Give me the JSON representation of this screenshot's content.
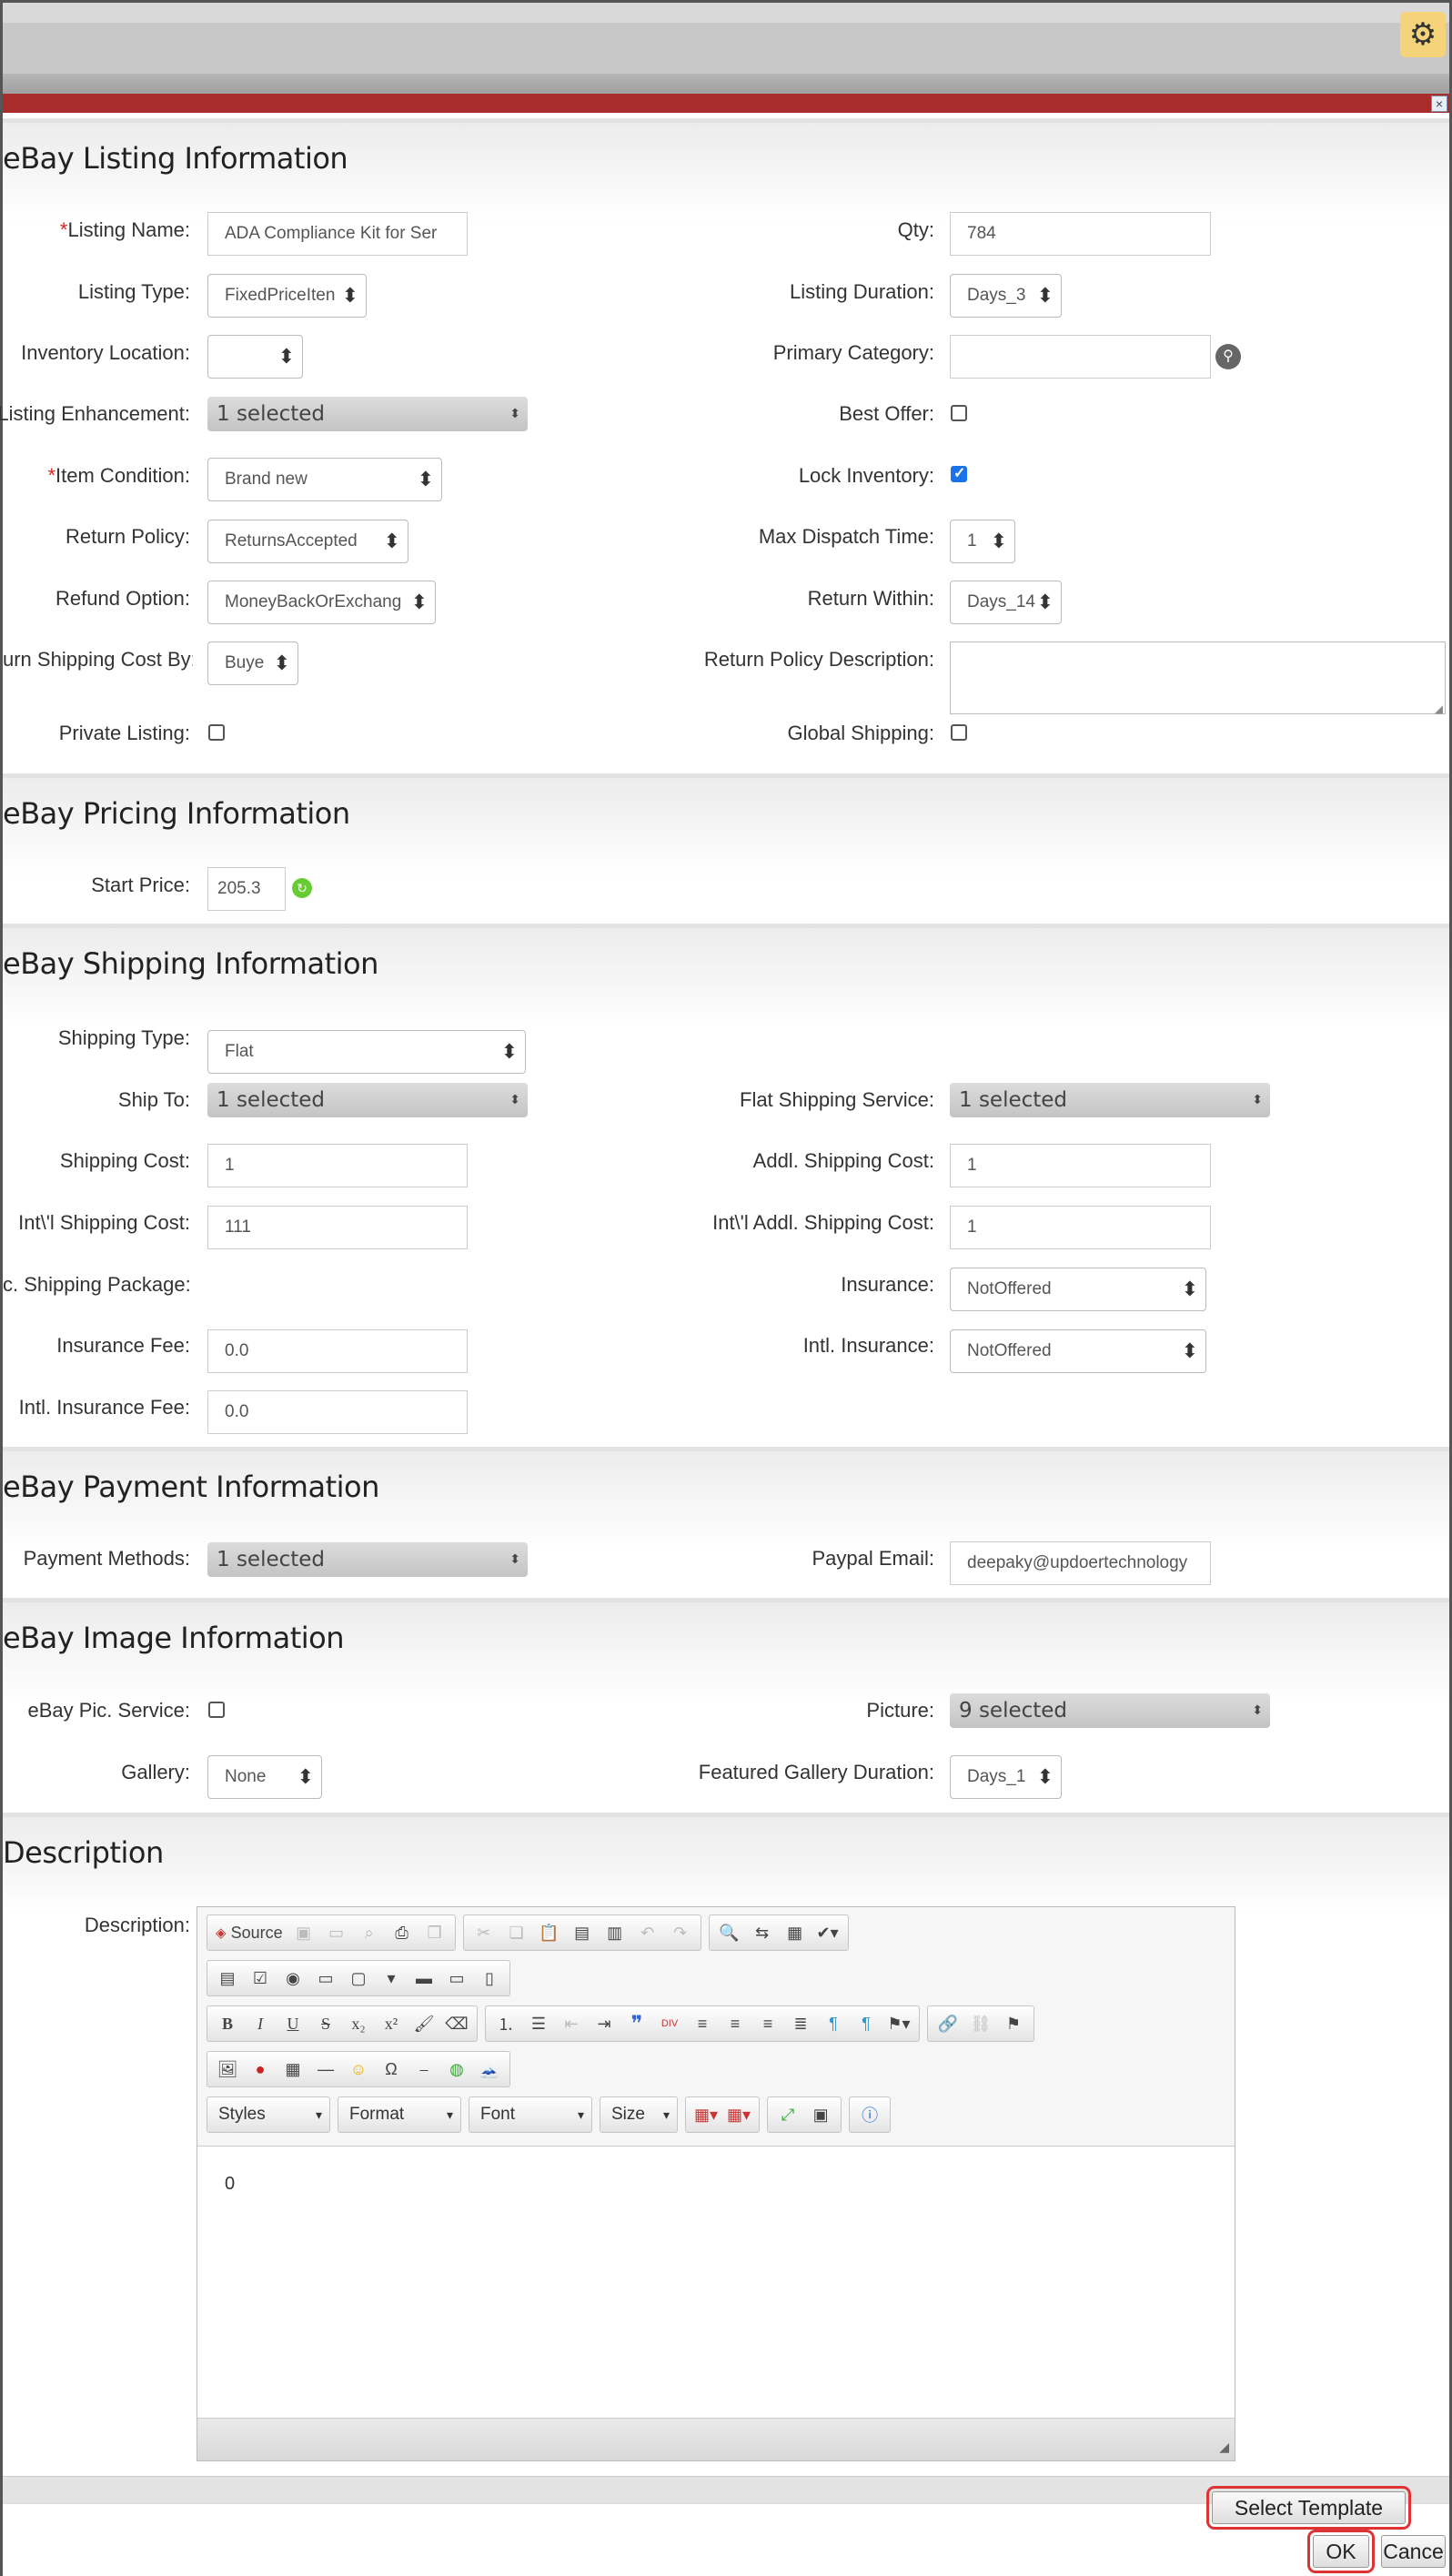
{
  "sections": {
    "listing": "eBay Listing Information",
    "pricing": "eBay Pricing Information",
    "shipping": "eBay Shipping Information",
    "payment": "eBay Payment Information",
    "image": "eBay Image Information",
    "description": "Description"
  },
  "listing": {
    "listing_name_label": "Listing Name:",
    "listing_name_value": "ADA Compliance Kit for Ser",
    "qty_label": "Qty:",
    "qty_value": "784",
    "listing_type_label": "Listing Type:",
    "listing_type_value": "FixedPriceIten",
    "listing_duration_label": "Listing Duration:",
    "listing_duration_value": "Days_3",
    "inventory_location_label": "Inventory Location:",
    "inventory_location_value": "",
    "primary_category_label": "Primary Category:",
    "primary_category_value": "",
    "listing_enhancement_label": "Listing Enhancement:",
    "listing_enhancement_value": "1 selected",
    "best_offer_label": "Best Offer:",
    "item_condition_label": "Item Condition:",
    "item_condition_value": "Brand new",
    "lock_inventory_label": "Lock Inventory:",
    "return_policy_label": "Return Policy:",
    "return_policy_value": "ReturnsAccepted",
    "max_dispatch_label": "Max Dispatch Time:",
    "max_dispatch_value": "1",
    "refund_option_label": "Refund Option:",
    "refund_option_value": "MoneyBackOrExchang",
    "return_within_label": "Return Within:",
    "return_within_value": "Days_14",
    "return_shipping_label": "urn Shipping Cost By:",
    "return_shipping_value": "Buye",
    "return_policy_desc_label": "Return Policy Description:",
    "private_listing_label": "Private Listing:",
    "global_shipping_label": "Global Shipping:"
  },
  "pricing": {
    "start_price_label": "Start Price:",
    "start_price_value": "205.3"
  },
  "shipping": {
    "shipping_type_label": "Shipping Type:",
    "shipping_type_value": "Flat",
    "ship_to_label": "Ship To:",
    "ship_to_value": "1 selected",
    "flat_service_label": "Flat Shipping Service:",
    "flat_service_value": "1 selected",
    "shipping_cost_label": "Shipping Cost:",
    "shipping_cost_value": "1",
    "addl_cost_label": "Addl. Shipping Cost:",
    "addl_cost_value": "1",
    "intl_cost_label": "Int\\'l Shipping Cost:",
    "intl_cost_value": "111",
    "intl_addl_cost_label": "Int\\'l Addl. Shipping Cost:",
    "intl_addl_cost_value": "1",
    "package_label": "c. Shipping Package:",
    "insurance_label": "Insurance:",
    "insurance_value": "NotOffered",
    "insurance_fee_label": "Insurance Fee:",
    "insurance_fee_value": "0.0",
    "intl_insurance_label": "Intl. Insurance:",
    "intl_insurance_value": "NotOffered",
    "intl_insurance_fee_label": "Intl. Insurance Fee:",
    "intl_insurance_fee_value": "0.0"
  },
  "payment": {
    "methods_label": "Payment Methods:",
    "methods_value": "1 selected",
    "paypal_label": "Paypal Email:",
    "paypal_value": "deepaky@updoertechnology"
  },
  "image": {
    "pic_service_label": "eBay Pic. Service:",
    "picture_label": "Picture:",
    "picture_value": "9 selected",
    "gallery_label": "Gallery:",
    "gallery_value": "None",
    "featured_label": "Featured Gallery Duration:",
    "featured_value": "Days_1"
  },
  "description": {
    "label": "Description:",
    "source_label": "Source",
    "styles_label": "Styles",
    "format_label": "Format",
    "font_label": "Font",
    "size_label": "Size",
    "content": "0"
  },
  "buttons": {
    "select_template": "Select Template",
    "ok": "OK",
    "cancel": "Cance"
  },
  "icons": {
    "settings": "gear-icon",
    "close": "close-icon",
    "search": "search-icon"
  }
}
